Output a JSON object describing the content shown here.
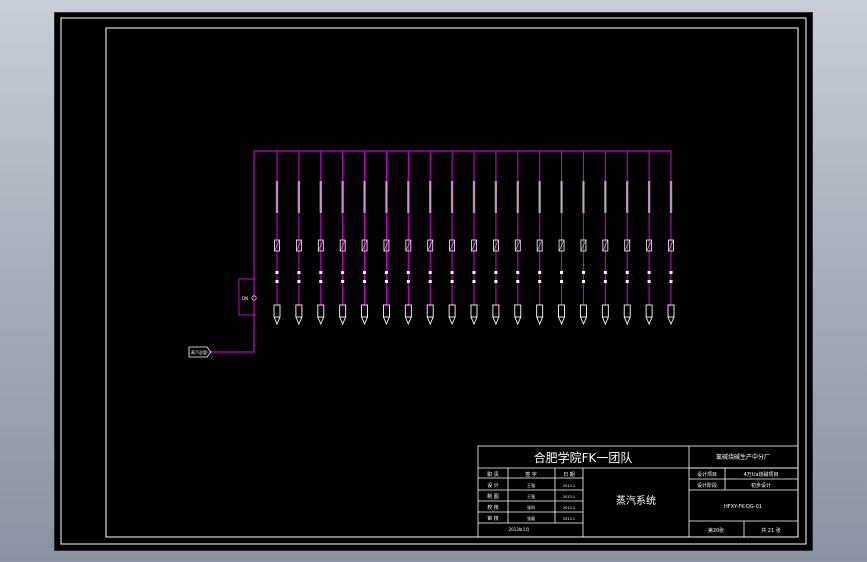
{
  "colors": {
    "background": "#000000",
    "frame": "#ffffff",
    "pipe": "#c800c8",
    "valve": "#ffffff"
  },
  "title_block": {
    "team": "合肥学院FK一团队",
    "plant": "氯碱烧碱生产中分厂",
    "drawing_title": "蒸汽系统",
    "drawing_no": "HFXY-FK-QG-01",
    "design_item_label": "设计项目",
    "design_item_value": "4万t/a烧碱项目",
    "design_stage_label": "设计阶段",
    "design_stage_value": "初步设计",
    "role_header": "职 责",
    "name_header": "签 字",
    "date_header": "日 期",
    "roles": [
      {
        "role": "设 计",
        "name": "王强",
        "date": "2013.1"
      },
      {
        "role": "制 图",
        "name": "王强",
        "date": "2013.1"
      },
      {
        "role": "校 核",
        "name": "张科",
        "date": "2013.1"
      },
      {
        "role": "审 核",
        "name": "张磊",
        "date": "2013.1"
      }
    ],
    "footer_date": "2013年1月",
    "sheet": "第20张",
    "total": "共 21 张"
  },
  "diagram": {
    "source_tag": "蒸汽总管",
    "bypass_label": "DN",
    "branch_count": 19
  }
}
